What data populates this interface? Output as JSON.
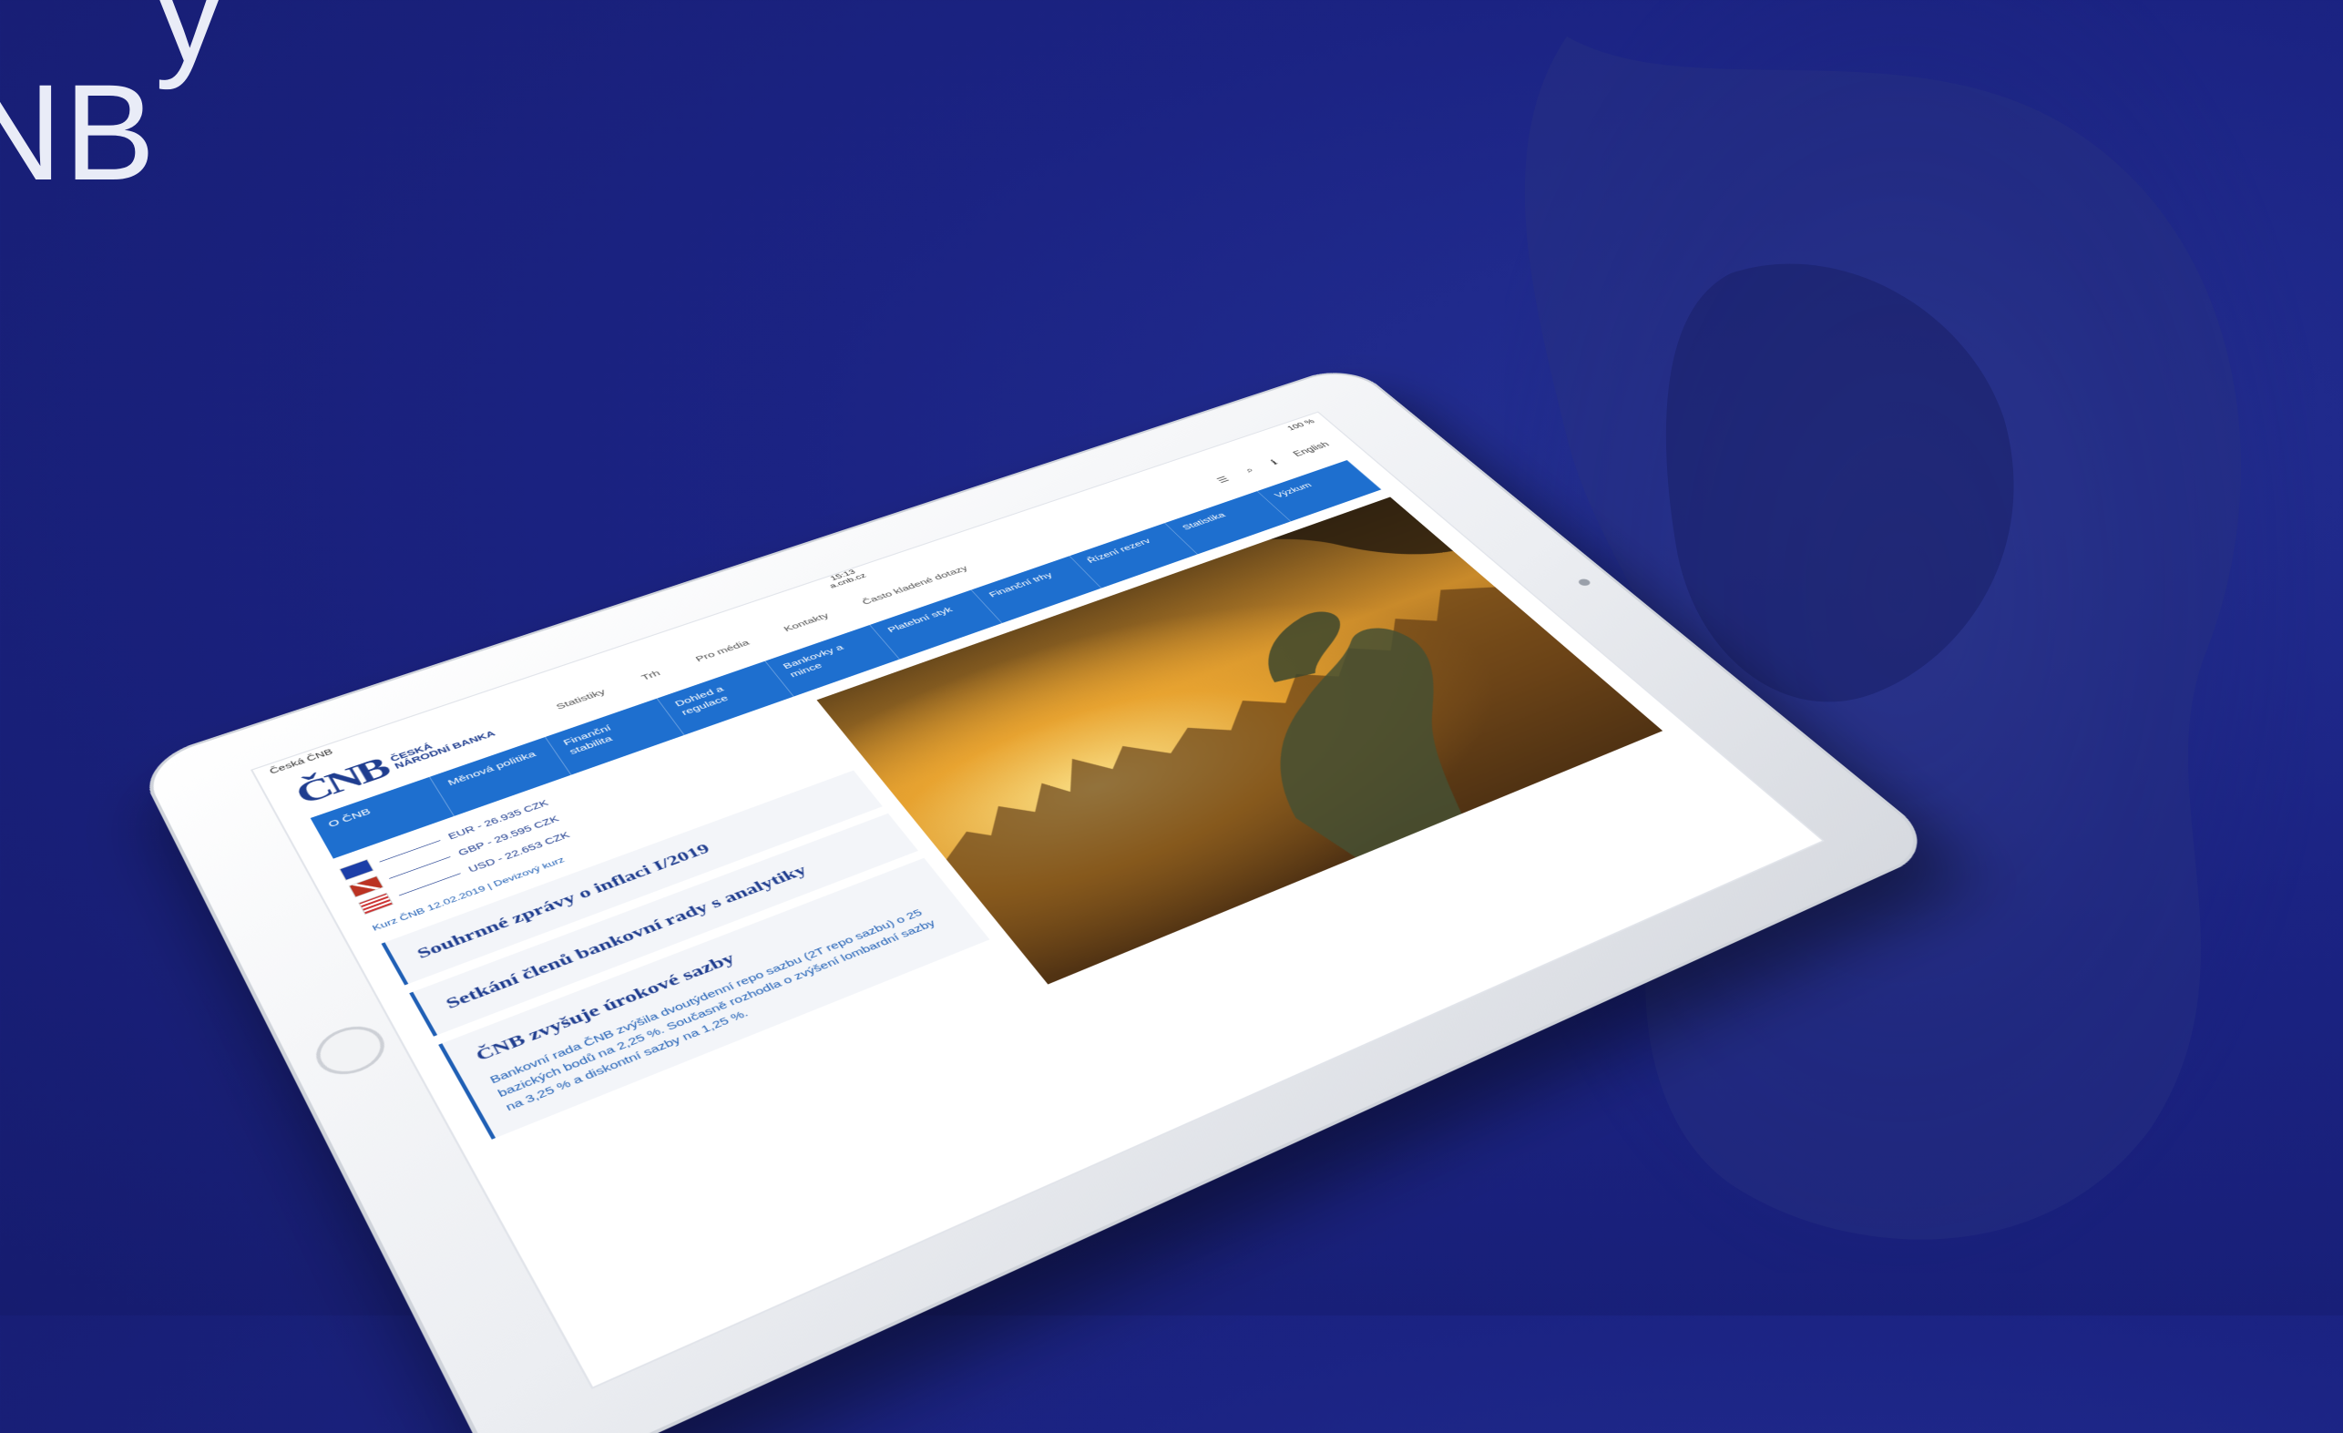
{
  "headline": {
    "line1": "y",
    "line2": "NB"
  },
  "statusbar": {
    "carrier": "Česká ČNB",
    "time": "15:13",
    "sub": "a.cnb.cz",
    "battery": "100 %"
  },
  "header": {
    "logo_mark": "ČNB",
    "logo_text_1": "ČESKÁ",
    "logo_text_2": "NÁRODNÍ BANKA",
    "top_links": [
      "Statistiky",
      "Trh",
      "Pro média",
      "Kontakty",
      "Často kladené dotazy"
    ],
    "lang": "English"
  },
  "nav": [
    "O ČNB",
    "Měnová politika",
    "Finanční stabilita",
    "Dohled a regulace",
    "Bankovky a mince",
    "Platební styk",
    "Finanční trhy",
    "Řízení rezerv",
    "Statistika",
    "Výzkum"
  ],
  "rates": [
    {
      "flag": "eu-flag",
      "text": "EUR - 26.935 CZK"
    },
    {
      "flag": "gb-flag",
      "text": "GBP - 29.595 CZK"
    },
    {
      "flag": "us-flag",
      "text": "USD - 22.653 CZK"
    }
  ],
  "kurz": "Kurz ČNB 12.02.2019 | Devizový kurz",
  "cards": [
    {
      "title": "Souhrnné zprávy o inflaci I/2019"
    },
    {
      "title": "Setkání členů bankovní rady s analytiky"
    },
    {
      "title": "ČNB zvyšuje úrokové sazby",
      "body": "Bankovní rada ČNB zvýšila dvoutýdenní repo sazbu (2T repo sazbu) o 25 bazických bodů na 2,25 %. Současně rozhodla o zvýšení lombardní sazby na 3,25 % a diskontní sazby na 1,25 %."
    }
  ]
}
